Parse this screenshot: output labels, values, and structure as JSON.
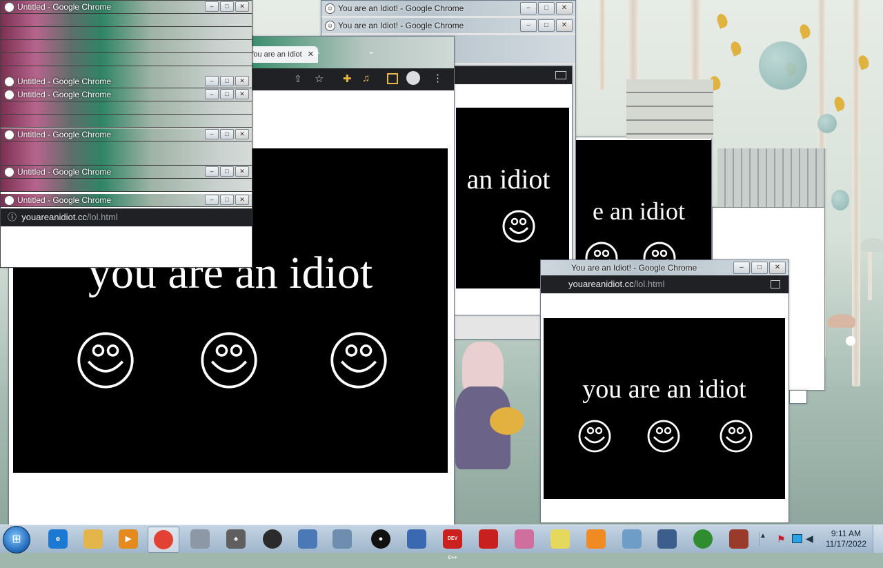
{
  "windows": {
    "stack_title": "Untitled - Google Chrome",
    "top_title": "You are an Idiot! - Google Chrome",
    "small_title": "You are an Idiot! - Google Chrome",
    "partial_title": "You are an Idiot! - Google Chrome",
    "tab_label": "You are an Idiot",
    "url_domain": "youareanidiot.cc",
    "url_path": "/lol.html",
    "url_domain_partial": "youareanidiot.cc",
    "main_text": "you are an idiot",
    "mid_text": "an idiot",
    "right_text": "e an idiot",
    "small_text": "you are an idiot",
    "min_symbol": "–",
    "max_symbol": "□",
    "close_symbol": "✕"
  },
  "taskbar": {
    "time": "9:11 AM",
    "date": "11/17/2022",
    "icons": [
      {
        "name": "internet-explorer",
        "label": "e",
        "color": "#1b79d2"
      },
      {
        "name": "file-explorer",
        "label": "",
        "color": "#e3b54a"
      },
      {
        "name": "media-player",
        "label": "▶",
        "color": "#e58a1f"
      },
      {
        "name": "chrome",
        "label": "",
        "color": "#e34133"
      },
      {
        "name": "calculator",
        "label": "",
        "color": "#8c98a6"
      },
      {
        "name": "solitaire",
        "label": "♠",
        "color": "#5f5f5f"
      },
      {
        "name": "app-record",
        "label": "",
        "color": "#2b2b2b"
      },
      {
        "name": "network",
        "label": "",
        "color": "#4a79b5"
      },
      {
        "name": "notepad",
        "label": "",
        "color": "#6e8eb0"
      },
      {
        "name": "record",
        "label": "●",
        "color": "#111111"
      },
      {
        "name": "remote",
        "label": "",
        "color": "#3a69b2"
      },
      {
        "name": "dev-cpp",
        "label": "DEV C++",
        "color": "#cc1f1f"
      },
      {
        "name": "adobe-pdf",
        "label": "",
        "color": "#c81f1f"
      },
      {
        "name": "snipping",
        "label": "",
        "color": "#cf6fa0"
      },
      {
        "name": "sticky-notes",
        "label": "",
        "color": "#e6d85c"
      },
      {
        "name": "uc-browser",
        "label": "",
        "color": "#f08a22"
      },
      {
        "name": "paint",
        "label": "",
        "color": "#6e9ec8"
      },
      {
        "name": "virtualbox",
        "label": "",
        "color": "#3c5e8c"
      },
      {
        "name": "windows-logo",
        "label": "",
        "color": "#2f8d2f"
      },
      {
        "name": "game",
        "label": "",
        "color": "#9a3a2a"
      }
    ]
  }
}
